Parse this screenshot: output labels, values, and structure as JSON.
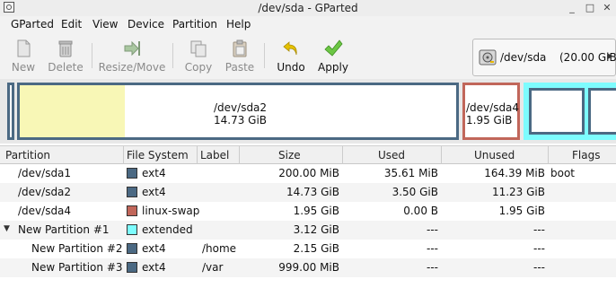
{
  "window": {
    "title": "/dev/sda - GParted",
    "controls": [
      "_",
      "□",
      "✕"
    ]
  },
  "menubar": {
    "items": [
      "GParted",
      "Edit",
      "View",
      "Device",
      "Partition",
      "Help"
    ]
  },
  "toolbar": {
    "new_label": "New",
    "delete_label": "Delete",
    "resize_label": "Resize/Move",
    "copy_label": "Copy",
    "paste_label": "Paste",
    "undo_label": "Undo",
    "apply_label": "Apply"
  },
  "device_selector": {
    "device": "/dev/sda",
    "size": "(20.00 GiB)"
  },
  "diskmap": {
    "sda2": {
      "name": "/dev/sda2",
      "size": "14.73 GiB",
      "used_fraction": 0.24
    },
    "sda4": {
      "name": "/dev/sda4",
      "size": "1.95 GiB"
    }
  },
  "colors": {
    "ext4": "#4b6983",
    "linux-swap": "#c1665a",
    "extended": "#7dfcfe",
    "used": "#f8f7b6",
    "selection_border": "#4b6983"
  },
  "table": {
    "headers": {
      "partition": "Partition",
      "filesystem": "File System",
      "label": "Label",
      "size": "Size",
      "used": "Used",
      "unused": "Unused",
      "flags": "Flags"
    },
    "rows": [
      {
        "partition": "/dev/sda1",
        "filesystem": "ext4",
        "label": "",
        "size": "200.00 MiB",
        "used": "35.61 MiB",
        "unused": "164.39 MiB",
        "flags": "boot"
      },
      {
        "partition": "/dev/sda2",
        "filesystem": "ext4",
        "label": "",
        "size": "14.73 GiB",
        "used": "3.50 GiB",
        "unused": "11.23 GiB",
        "flags": ""
      },
      {
        "partition": "/dev/sda4",
        "filesystem": "linux-swap",
        "label": "",
        "size": "1.95 GiB",
        "used": "0.00 B",
        "unused": "1.95 GiB",
        "flags": ""
      },
      {
        "partition": "New Partition #1",
        "filesystem": "extended",
        "label": "",
        "size": "3.12 GiB",
        "used": "---",
        "unused": "---",
        "flags": ""
      },
      {
        "partition": "New Partition #2",
        "filesystem": "ext4",
        "label": "/home",
        "size": "2.15 GiB",
        "used": "---",
        "unused": "---",
        "flags": ""
      },
      {
        "partition": "New Partition #3",
        "filesystem": "ext4",
        "label": "/var",
        "size": "999.00 MiB",
        "used": "---",
        "unused": "---",
        "flags": ""
      }
    ]
  }
}
